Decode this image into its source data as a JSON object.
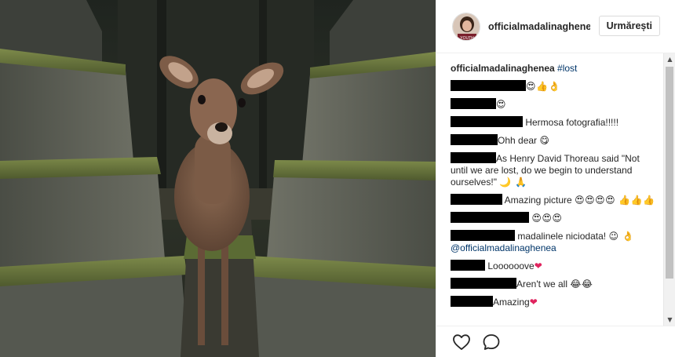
{
  "post": {
    "username": "officialmadalinaghenea",
    "avatar_label": "YOUTH",
    "follow_label": "Urmărești",
    "image_subject": "deer-among-mossy-stone-steps"
  },
  "caption": {
    "author": "officialmadalinaghenea",
    "hashtag": "#lost"
  },
  "comments": [
    {
      "redact_width": 96,
      "text": "",
      "emoji": "😍👍👌"
    },
    {
      "redact_width": 58,
      "text": "",
      "emoji": "😍"
    },
    {
      "redact_width": 92,
      "text": "Hermosa fotografia!!!!!",
      "emoji": ""
    },
    {
      "redact_width": 60,
      "text": "Ohh dear",
      "emoji": "😋"
    },
    {
      "redact_width": 58,
      "text": "As Henry David Thoreau said \"Not until we are lost, do we begin to understand ourselves!\"",
      "emoji": "🌙 🙏"
    },
    {
      "redact_width": 66,
      "text": "Amazing picture",
      "emoji": "😍😍😍😍 👍👍👍"
    },
    {
      "redact_width": 100,
      "text": "",
      "emoji": "😍😍😍"
    },
    {
      "redact_width": 82,
      "text": "madalinele niciodata!",
      "emoji": "😉 👌",
      "mention": "@officialmadalinaghenea"
    },
    {
      "redact_width": 44,
      "text": "Loooooove",
      "emoji": "❤"
    },
    {
      "redact_width": 84,
      "text": "Aren't we all",
      "emoji": "😂😂"
    },
    {
      "redact_width": 54,
      "text": "Amazing",
      "emoji": "❤"
    }
  ],
  "actions": {
    "like_icon": "heart-outline-icon",
    "comment_icon": "speech-bubble-icon"
  },
  "colors": {
    "link": "#003569",
    "border": "#efefef",
    "text": "#262626"
  }
}
